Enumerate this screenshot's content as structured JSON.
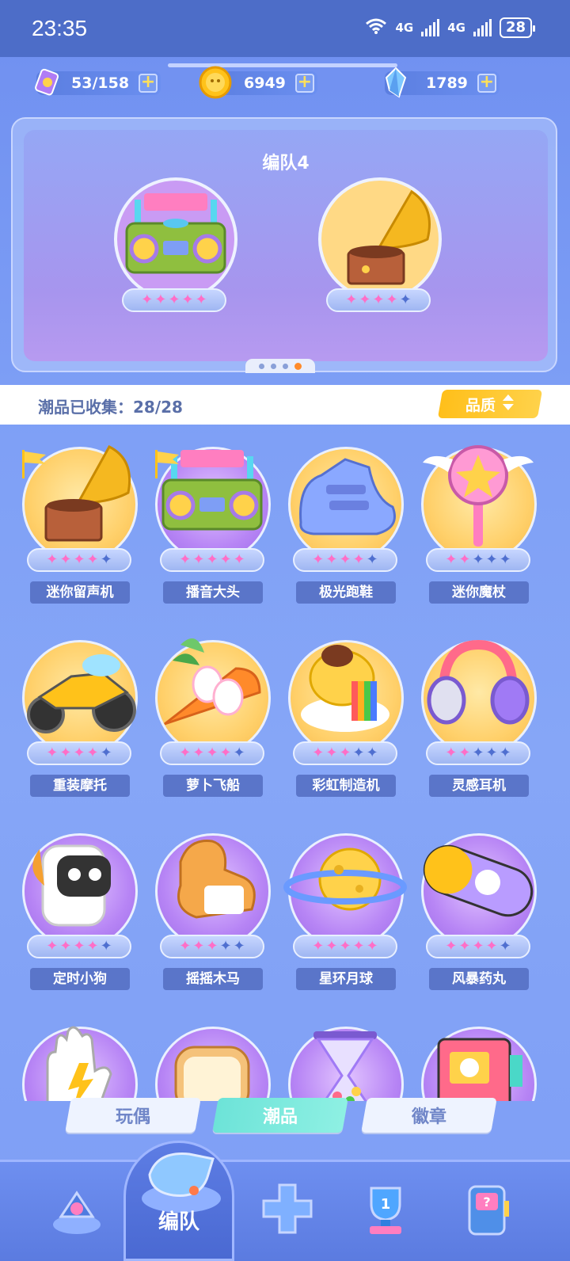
{
  "status_bar": {
    "time": "23:35",
    "network_1": "4G",
    "network_2": "4G",
    "battery": "28"
  },
  "currencies": [
    {
      "icon": "ticket-icon",
      "value": "53/158"
    },
    {
      "icon": "coin-icon",
      "value": "6949"
    },
    {
      "icon": "crystal-icon",
      "value": "1789"
    }
  ],
  "team": {
    "title": "编队4",
    "slots": [
      {
        "item": "boombox",
        "stars_on": 5,
        "stars_total": 5
      },
      {
        "item": "gramophone",
        "stars_on": 4,
        "stars_total": 5
      }
    ],
    "page_count": 4,
    "active_page": 4
  },
  "collection": {
    "label": "潮品已收集：28/28",
    "sort_button": "品质"
  },
  "items": [
    {
      "name": "迷你留声机",
      "style": "gold",
      "stars_on": 4,
      "flag": true,
      "art": "gramophone"
    },
    {
      "name": "播音大头",
      "style": "purple",
      "stars_on": 5,
      "flag": true,
      "art": "boombox"
    },
    {
      "name": "极光跑鞋",
      "style": "gold",
      "stars_on": 4,
      "flag": false,
      "art": "shoe"
    },
    {
      "name": "迷你魔杖",
      "style": "gold",
      "stars_on": 2,
      "flag": false,
      "art": "wand"
    },
    {
      "name": "重装摩托",
      "style": "gold",
      "stars_on": 4,
      "flag": false,
      "art": "moto"
    },
    {
      "name": "萝卜飞船",
      "style": "gold",
      "stars_on": 4,
      "flag": false,
      "art": "carrot"
    },
    {
      "name": "彩虹制造机",
      "style": "gold",
      "stars_on": 3,
      "flag": false,
      "art": "rainbow"
    },
    {
      "name": "灵感耳机",
      "style": "gold",
      "stars_on": 2,
      "flag": false,
      "art": "headphones"
    },
    {
      "name": "定时小狗",
      "style": "purple",
      "stars_on": 4,
      "flag": false,
      "art": "dog"
    },
    {
      "name": "摇摇木马",
      "style": "purple",
      "stars_on": 3,
      "flag": false,
      "art": "horse"
    },
    {
      "name": "星环月球",
      "style": "purple",
      "stars_on": 5,
      "flag": false,
      "art": "planet"
    },
    {
      "name": "风暴药丸",
      "style": "purple",
      "stars_on": 4,
      "flag": false,
      "art": "pill"
    },
    {
      "name": "",
      "style": "purple",
      "stars_on": 0,
      "flag": false,
      "art": "glove"
    },
    {
      "name": "",
      "style": "purple",
      "stars_on": 0,
      "flag": false,
      "art": "toast"
    },
    {
      "name": "",
      "style": "purple",
      "stars_on": 0,
      "flag": false,
      "art": "hourglass"
    },
    {
      "name": "",
      "style": "purple",
      "stars_on": 0,
      "flag": false,
      "art": "machine"
    }
  ],
  "tabs": [
    {
      "label": "玩偶",
      "active": false
    },
    {
      "label": "潮品",
      "active": true
    },
    {
      "label": "徽章",
      "active": false
    }
  ],
  "bottom_nav": {
    "active_label": "编队",
    "items": [
      "home-icon",
      "whistle-icon",
      "gamepad-icon",
      "trophy-icon",
      "slot-machine-icon"
    ]
  },
  "colors": {
    "star_on": "#ff6ec7",
    "star_off": "#4f6fd0",
    "accent_quality": "#ffbf1a",
    "tab_active": "#6de3d8"
  }
}
